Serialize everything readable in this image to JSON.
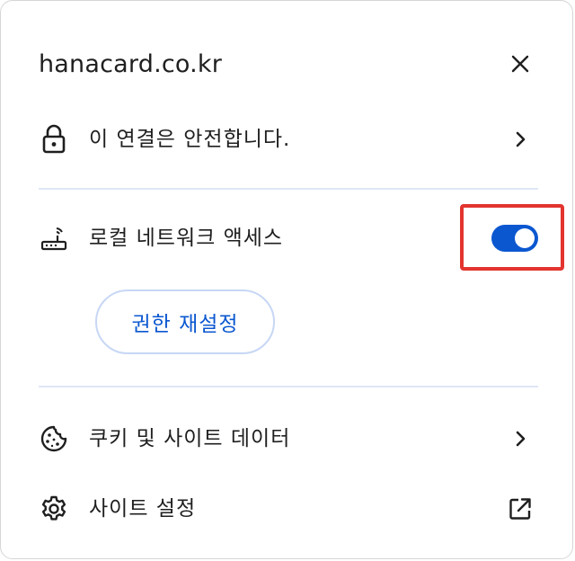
{
  "header": {
    "site": "hanacard.co.kr",
    "close_icon": "close-icon"
  },
  "rows": {
    "connection": {
      "label": "이 연결은 안전합니다.",
      "icon": "lock-icon",
      "trail_icon": "chevron-right-icon"
    },
    "local_network": {
      "label": "로컬 네트워크 액세스",
      "icon": "router-icon",
      "toggle_on": true
    },
    "cookies": {
      "label": "쿠키 및 사이트 데이터",
      "icon": "cookie-icon",
      "trail_icon": "chevron-right-icon"
    },
    "site_settings": {
      "label": "사이트 설정",
      "icon": "gear-icon",
      "trail_icon": "open-in-new-icon"
    }
  },
  "reset_button": {
    "label": "권한 재설정"
  },
  "colors": {
    "accent": "#0b57d0",
    "highlight": "#e3342f",
    "divider": "#dfe7f6"
  }
}
